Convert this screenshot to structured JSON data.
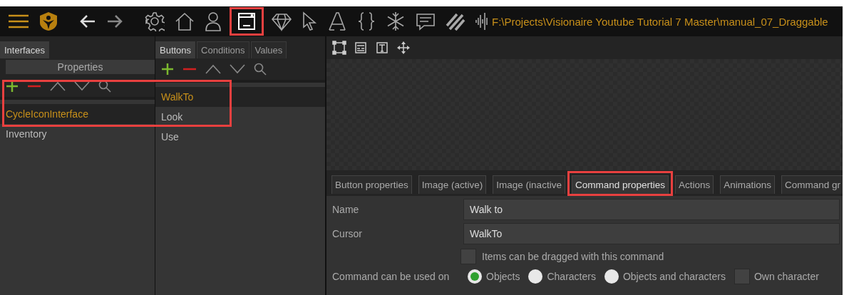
{
  "toolbar": {
    "tools": [
      {
        "kind": "menu",
        "selected": false,
        "highlighted": false
      },
      {
        "kind": "logo",
        "selected": false,
        "highlighted": false
      },
      {
        "kind": "back",
        "selected": false,
        "highlighted": false
      },
      {
        "kind": "forward",
        "selected": false,
        "highlighted": false
      },
      {
        "kind": "gear",
        "selected": false,
        "highlighted": false
      },
      {
        "kind": "home",
        "selected": false,
        "highlighted": false
      },
      {
        "kind": "person",
        "selected": false,
        "highlighted": false
      },
      {
        "kind": "window",
        "selected": true,
        "highlighted": true
      },
      {
        "kind": "diamond",
        "selected": false,
        "highlighted": false
      },
      {
        "kind": "cursor",
        "selected": false,
        "highlighted": false
      },
      {
        "kind": "font",
        "selected": false,
        "highlighted": false
      },
      {
        "kind": "braces",
        "selected": false,
        "highlighted": false
      },
      {
        "kind": "snowflake",
        "selected": false,
        "highlighted": false
      },
      {
        "kind": "chat",
        "selected": false,
        "highlighted": false
      },
      {
        "kind": "stripes",
        "selected": false,
        "highlighted": false
      },
      {
        "kind": "waveform",
        "selected": false,
        "highlighted": false
      }
    ],
    "project_path": "F:\\Projects\\Visionaire Youtube Tutorial 7 Master\\manual_07_Draggable"
  },
  "interfaces_panel": {
    "tabs": [
      {
        "label": "Interfaces",
        "selected": true
      }
    ],
    "subheader": "Properties",
    "items": [
      {
        "label": "CycleIconInterface",
        "selected": true
      },
      {
        "label": "Inventory",
        "selected": false
      }
    ]
  },
  "buttons_panel": {
    "tabs": [
      {
        "label": "Buttons",
        "selected": true
      },
      {
        "label": "Conditions",
        "selected": false
      },
      {
        "label": "Values",
        "selected": false
      }
    ],
    "items": [
      {
        "label": "WalkTo",
        "selected": true
      },
      {
        "label": "Look",
        "selected": false
      },
      {
        "label": "Use",
        "selected": false
      }
    ]
  },
  "list_highlight": true,
  "editor": {
    "tabs": [
      {
        "label": "Button properties",
        "selected": false,
        "highlighted": false
      },
      {
        "label": "Image (active)",
        "selected": false,
        "highlighted": false
      },
      {
        "label": "Image (inactive",
        "selected": false,
        "highlighted": false
      },
      {
        "label": "Command properties",
        "selected": true,
        "highlighted": true
      },
      {
        "label": "Actions",
        "selected": false,
        "highlighted": false
      },
      {
        "label": "Animations",
        "selected": false,
        "highlighted": false
      },
      {
        "label": "Command gr",
        "selected": false,
        "highlighted": false
      }
    ],
    "fields": [
      {
        "label": "Name",
        "value": "Walk to"
      },
      {
        "label": "Cursor",
        "value": "WalkTo"
      }
    ],
    "drag_checkbox": {
      "label": "Items can be dragged with this command",
      "checked": false
    },
    "used_on": {
      "label": "Command can be used on",
      "options": [
        {
          "label": "Objects",
          "selected": true
        },
        {
          "label": "Characters",
          "selected": false
        },
        {
          "label": "Objects and characters",
          "selected": false
        }
      ]
    },
    "own_character": {
      "label": "Own character",
      "checked": false
    }
  }
}
